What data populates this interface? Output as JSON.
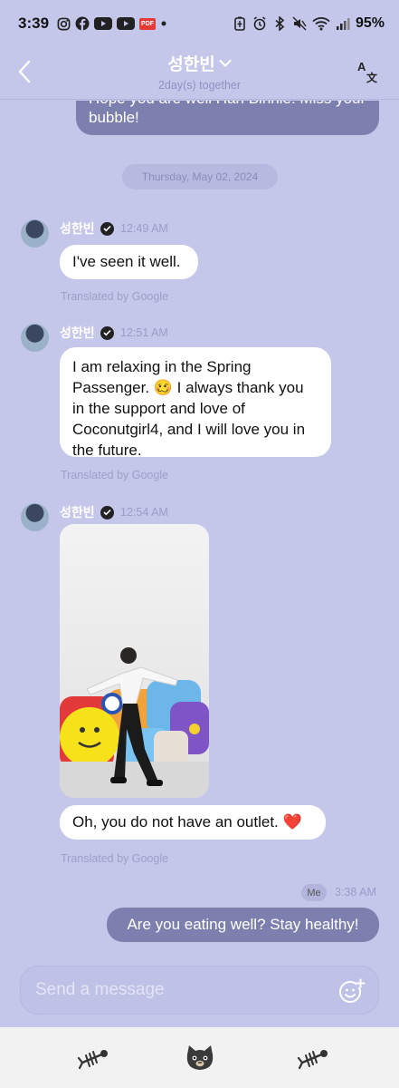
{
  "status_bar": {
    "time": "3:39",
    "battery": "95%",
    "icons_left": [
      "instagram-icon",
      "facebook-icon",
      "youtube-icon",
      "youtube-icon",
      "pdf-icon",
      "dot-icon"
    ],
    "icons_right": [
      "battery-saver-icon",
      "alarm-icon",
      "bluetooth-icon",
      "mute-icon",
      "wifi-icon",
      "signal-icon"
    ],
    "pdf_label": "PDF"
  },
  "header": {
    "title": "성한빈",
    "subtitle": "2day(s) together",
    "translate_icon": "translate-icon"
  },
  "conversation": {
    "outgoing_top": "Hope you are well Han Binnie!  Miss your bubble!",
    "date_divider": "Thursday, May 02, 2024",
    "messages": [
      {
        "sender": "성한빈",
        "time": "12:49 AM",
        "text": "I've seen it well.",
        "translated": "Translated by Google"
      },
      {
        "sender": "성한빈",
        "time": "12:51 AM",
        "text": "I am relaxing in the Spring Passenger. 🥴 I always thank you in the support and love of Coconutgirl4, and I will love you in the future.",
        "translated": "Translated by Google"
      },
      {
        "sender": "성한빈",
        "time": "12:54 AM",
        "image": "photo of person sitting on colorful cushions",
        "text": "Oh, you do not have an outlet. ❤️",
        "translated": "Translated by Google"
      }
    ],
    "me_badge": "Me",
    "me_time": "3:38 AM",
    "me_message": "Are you eating well?  Stay healthy!"
  },
  "composer": {
    "placeholder": "Send a message",
    "emoji_icon": "emoji-add-icon"
  },
  "nav": {
    "left_icon": "fishbone-icon",
    "center_icon": "cat-face-icon",
    "right_icon": "fishbone-icon"
  },
  "colors": {
    "background": "#c5c7ea",
    "my_bubble": "#7d80ae",
    "their_bubble": "#ffffff",
    "accent_heart": "#e8415a"
  }
}
